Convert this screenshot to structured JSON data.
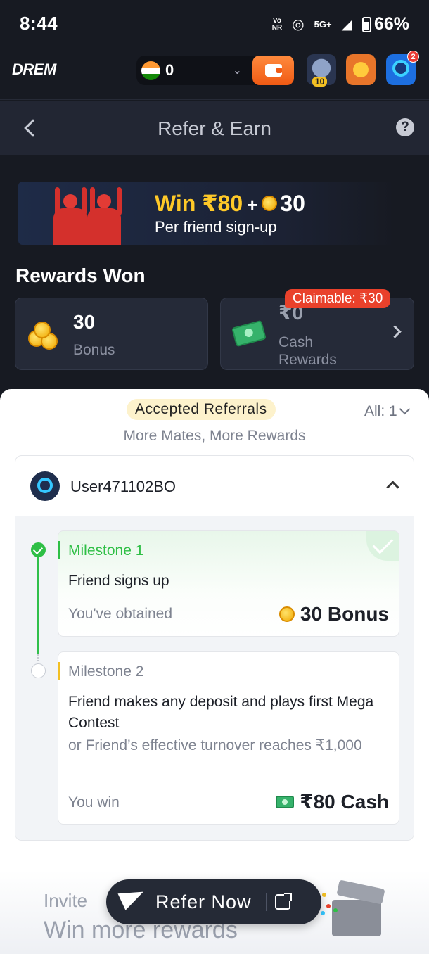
{
  "status_bar": {
    "time": "8:44",
    "volte_top": "Vo",
    "volte_bottom": "NR",
    "network": "5G+",
    "battery": "66%"
  },
  "header": {
    "logo": "DREM",
    "balance": "0",
    "pot_badge": "10",
    "notification_count": "2"
  },
  "titlebar": {
    "title": "Refer & Earn",
    "help_label": "?"
  },
  "banner": {
    "win_amount": "Win ₹80",
    "plus": "+",
    "bonus_points": "30",
    "subtitle": "Per friend sign-up"
  },
  "rewards": {
    "title": "Rewards Won",
    "bonus": {
      "value": "30",
      "label": "Bonus"
    },
    "cash": {
      "value": "₹0",
      "label_line1": "Cash",
      "label_line2": "Rewards",
      "claim_badge": "Claimable: ₹30"
    }
  },
  "referrals": {
    "pill": "Accepted Referrals",
    "filter": "All: 1",
    "tagline": "More Mates, More Rewards",
    "user": {
      "name": "User471102BO"
    },
    "milestones": [
      {
        "title": "Milestone 1",
        "description": "Friend signs up",
        "left_label": "You've obtained",
        "reward": "30 Bonus",
        "completed": true
      },
      {
        "title": "Milestone 2",
        "description": "Friend makes any deposit and plays first Mega Contest",
        "alternative": "or Friend’s effective turnover reaches ₹1,000",
        "left_label": "You win",
        "reward": "₹80 Cash",
        "completed": false
      }
    ]
  },
  "bottom": {
    "invite_line1": "Invite",
    "invite_line2": "Win more rewards",
    "refer_button": "Refer Now"
  },
  "colors": {
    "accent_gold": "#ffc928",
    "claim_red": "#e9412b",
    "success_green": "#2fbf46",
    "dark_bg": "#171a22"
  }
}
